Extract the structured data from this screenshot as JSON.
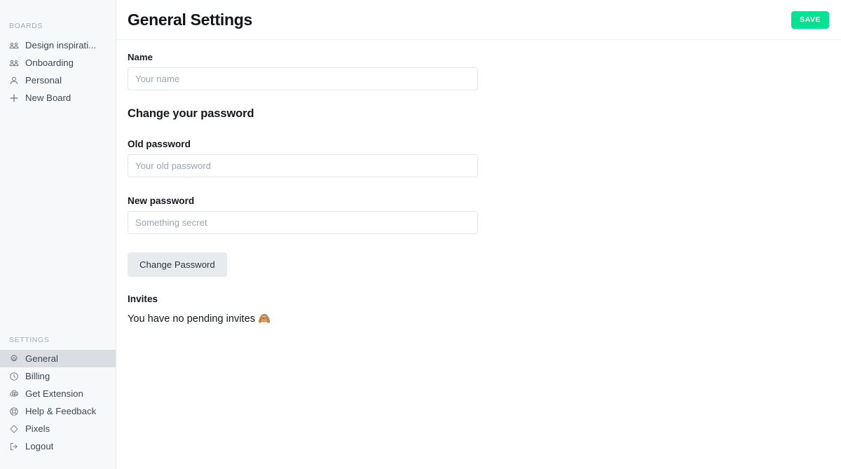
{
  "sidebar": {
    "boards_label": "BOARDS",
    "boards": [
      {
        "label": "Design inspirati...",
        "icon": "users-group-icon"
      },
      {
        "label": "Onboarding",
        "icon": "users-group-icon"
      },
      {
        "label": "Personal",
        "icon": "user-icon"
      },
      {
        "label": "New Board",
        "icon": "plus-icon"
      }
    ],
    "settings_label": "SETTINGS",
    "settings": [
      {
        "label": "General",
        "icon": "gear-icon",
        "active": true
      },
      {
        "label": "Billing",
        "icon": "clock-icon",
        "active": false
      },
      {
        "label": "Get Extension",
        "icon": "cloud-download-icon",
        "active": false
      },
      {
        "label": "Help & Feedback",
        "icon": "help-buoy-icon",
        "active": false
      },
      {
        "label": "Pixels",
        "icon": "diamond-icon",
        "active": false
      },
      {
        "label": "Logout",
        "icon": "logout-icon",
        "active": false
      }
    ]
  },
  "header": {
    "title": "General Settings",
    "save_label": "SAVE",
    "save_color": "#00e392"
  },
  "form": {
    "name_label": "Name",
    "name_value": "",
    "name_placeholder": "Your name",
    "password_heading": "Change your password",
    "old_password_label": "Old password",
    "old_password_value": "",
    "old_password_placeholder": "Your old password",
    "new_password_label": "New password",
    "new_password_value": "",
    "new_password_placeholder": "Something secret",
    "change_password_label": "Change Password"
  },
  "invites": {
    "heading": "Invites",
    "message": "You have no pending invites",
    "emoji": "🙈"
  }
}
